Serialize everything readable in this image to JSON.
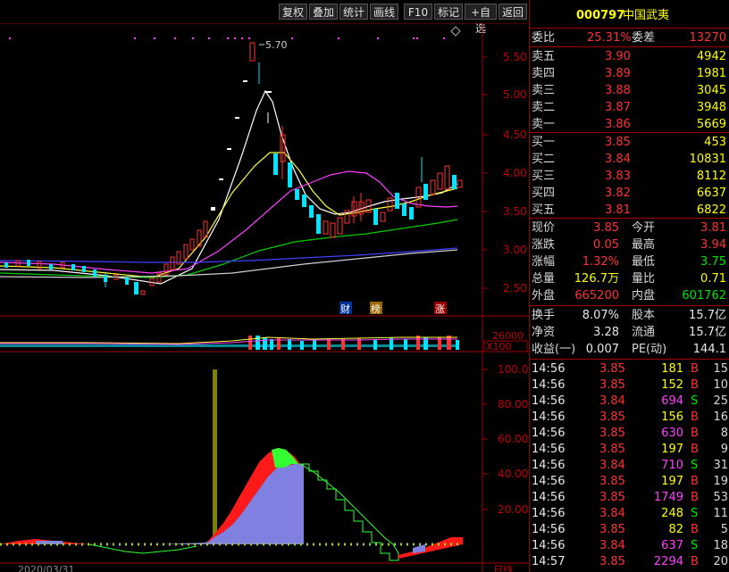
{
  "toolbar": {
    "buttons": [
      "复权",
      "叠加",
      "统计",
      "画线",
      "F10",
      "标记",
      "+自选",
      "返回"
    ]
  },
  "main_chart": {
    "y_ticks": [
      "5.50",
      "5.00",
      "4.50",
      "4.00",
      "3.50",
      "3.00",
      "2.50"
    ],
    "max_marker": "5.70",
    "event_tags": [
      "财",
      "榜",
      "涨"
    ]
  },
  "volume_panel": {
    "value_label": "26000",
    "unit_label": "X100"
  },
  "indicator_panel": {
    "y_ticks": [
      "100.0",
      "80.00",
      "60.00",
      "40.00",
      "20.00"
    ]
  },
  "bottom_axis": {
    "left_label": "2020/03/31",
    "right_label": "日线"
  },
  "stock": {
    "code": "000797",
    "name": "中国武夷"
  },
  "order_ratio": {
    "ratio_label": "委比",
    "ratio_value": "25.31%",
    "diff_label": "委差",
    "diff_value": "13270"
  },
  "asks": [
    {
      "label": "卖五",
      "price": "3.90",
      "volume": "4942"
    },
    {
      "label": "卖四",
      "price": "3.89",
      "volume": "1981"
    },
    {
      "label": "卖三",
      "price": "3.88",
      "volume": "3045"
    },
    {
      "label": "卖二",
      "price": "3.87",
      "volume": "3948"
    },
    {
      "label": "卖一",
      "price": "3.86",
      "volume": "5669"
    }
  ],
  "bids": [
    {
      "label": "买一",
      "price": "3.85",
      "volume": "453"
    },
    {
      "label": "买二",
      "price": "3.84",
      "volume": "10831"
    },
    {
      "label": "买三",
      "price": "3.83",
      "volume": "8112"
    },
    {
      "label": "买四",
      "price": "3.82",
      "volume": "6637"
    },
    {
      "label": "买五",
      "price": "3.81",
      "volume": "6822"
    }
  ],
  "stats": [
    {
      "l1": "现价",
      "v1": "3.85",
      "c1": "red",
      "l2": "今开",
      "v2": "3.81",
      "c2": "red"
    },
    {
      "l1": "涨跌",
      "v1": "0.05",
      "c1": "red",
      "l2": "最高",
      "v2": "3.94",
      "c2": "red"
    },
    {
      "l1": "涨幅",
      "v1": "1.32%",
      "c1": "red",
      "l2": "最低",
      "v2": "3.75",
      "c2": "grn"
    },
    {
      "l1": "总量",
      "v1": "126.7万",
      "c1": "yel",
      "l2": "量比",
      "v2": "0.71",
      "c2": "yel"
    },
    {
      "l1": "外盘",
      "v1": "665200",
      "c1": "red",
      "l2": "内盘",
      "v2": "601762",
      "c2": "grn"
    }
  ],
  "stats2": [
    {
      "l1": "换手",
      "v1": "8.07%",
      "l2": "股本",
      "v2": "15.7亿"
    },
    {
      "l1": "净资",
      "v1": "3.28",
      "l2": "流通",
      "v2": "15.7亿"
    },
    {
      "l1": "收益(一)",
      "v1": "0.007",
      "l2": "PE(动)",
      "v2": "144.1"
    }
  ],
  "ticks": [
    {
      "time": "14:56",
      "price": "3.85",
      "vol": "181",
      "side": "B",
      "n": "15"
    },
    {
      "time": "14:56",
      "price": "3.85",
      "vol": "152",
      "side": "B",
      "n": "10"
    },
    {
      "time": "14:56",
      "price": "3.84",
      "vol": "694",
      "side": "S",
      "n": "25"
    },
    {
      "time": "14:56",
      "price": "3.85",
      "vol": "156",
      "side": "B",
      "n": "16"
    },
    {
      "time": "14:56",
      "price": "3.85",
      "vol": "630",
      "side": "B",
      "n": "8"
    },
    {
      "time": "14:56",
      "price": "3.85",
      "vol": "197",
      "side": "B",
      "n": "9"
    },
    {
      "time": "14:56",
      "price": "3.84",
      "vol": "710",
      "side": "S",
      "n": "31"
    },
    {
      "time": "14:56",
      "price": "3.85",
      "vol": "197",
      "side": "B",
      "n": "19"
    },
    {
      "time": "14:56",
      "price": "3.85",
      "vol": "1749",
      "side": "B",
      "n": "53"
    },
    {
      "time": "14:56",
      "price": "3.84",
      "vol": "248",
      "side": "S",
      "n": "11"
    },
    {
      "time": "14:56",
      "price": "3.85",
      "vol": "82",
      "side": "B",
      "n": "5"
    },
    {
      "time": "14:56",
      "price": "3.84",
      "vol": "637",
      "side": "S",
      "n": "18"
    },
    {
      "time": "14:57",
      "price": "3.85",
      "vol": "2294",
      "side": "B",
      "n": "20"
    }
  ]
}
